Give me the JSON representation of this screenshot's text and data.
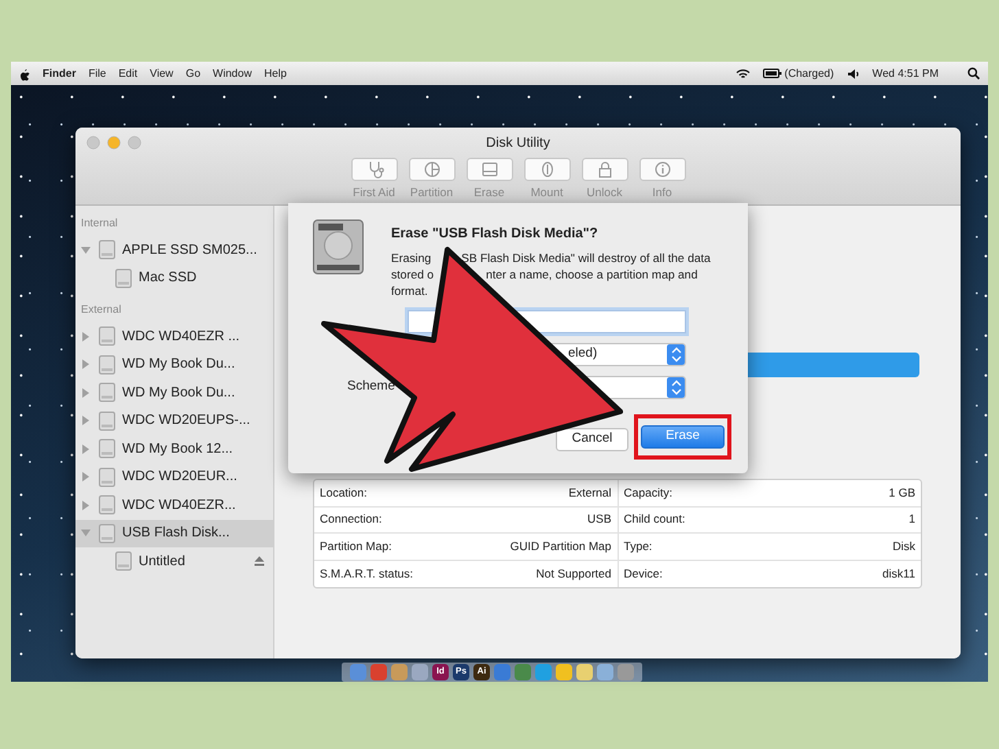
{
  "menu_bar": {
    "app": "Finder",
    "menus": [
      "File",
      "Edit",
      "View",
      "Go",
      "Window",
      "Help"
    ],
    "battery_status": "(Charged)",
    "clock": "Wed 4:51 PM"
  },
  "window": {
    "title": "Disk Utility",
    "toolbar": [
      {
        "label": "First Aid",
        "kind": "firstaid",
        "disabled": true
      },
      {
        "label": "Partition",
        "kind": "partition",
        "disabled": true
      },
      {
        "label": "Erase",
        "kind": "erase",
        "disabled": true
      },
      {
        "label": "Mount",
        "kind": "mount",
        "disabled": true
      },
      {
        "label": "Unlock",
        "kind": "unlock",
        "disabled": true
      },
      {
        "label": "Info",
        "kind": "info",
        "disabled": true
      }
    ],
    "sidebar": [
      {
        "title": "Internal",
        "items": [
          {
            "label": "APPLE SSD SM025...",
            "expanded": true,
            "selected": false,
            "children": [
              {
                "label": "Mac SSD",
                "selected": false,
                "ejectable": false
              }
            ]
          }
        ]
      },
      {
        "title": "External",
        "items": [
          {
            "label": "WDC WD40EZR ...",
            "expanded": false,
            "selected": false
          },
          {
            "label": "WD My Book Du...",
            "expanded": false,
            "selected": false
          },
          {
            "label": "WD My Book Du...",
            "expanded": false,
            "selected": false
          },
          {
            "label": "WDC WD20EUPS-...",
            "expanded": false,
            "selected": false
          },
          {
            "label": "WD My Book 12...",
            "expanded": false,
            "selected": false
          },
          {
            "label": "WDC WD20EUR...",
            "expanded": false,
            "selected": false
          },
          {
            "label": "WDC WD40EZR...",
            "expanded": false,
            "selected": false
          },
          {
            "label": "USB Flash Disk...",
            "expanded": true,
            "selected": true,
            "children": [
              {
                "label": "Untitled",
                "selected": false,
                "ejectable": true
              }
            ]
          }
        ]
      }
    ],
    "info_rows": [
      [
        {
          "label": "Location:",
          "value": "External"
        },
        {
          "label": "Capacity:",
          "value": "1 GB"
        }
      ],
      [
        {
          "label": "Connection:",
          "value": "USB"
        },
        {
          "label": "Child count:",
          "value": "1"
        }
      ],
      [
        {
          "label": "Partition Map:",
          "value": "GUID Partition Map"
        },
        {
          "label": "Type:",
          "value": "Disk"
        }
      ],
      [
        {
          "label": "S.M.A.R.T. status:",
          "value": "Not Supported"
        },
        {
          "label": "Device:",
          "value": "disk11"
        }
      ]
    ]
  },
  "dialog": {
    "title": "Erase \"USB Flash Disk Media\"?",
    "message_lines": [
      [
        "Erasing",
        "SB Flash Disk Media\" will destroy of all the data"
      ],
      [
        "stored o",
        "nter a name, choose a partition map and"
      ],
      [
        "format."
      ]
    ],
    "format_value": "eled)",
    "scheme_label": "Scheme",
    "buttons": [
      {
        "label": "Cancel",
        "kind": "secondary",
        "highlighted": false
      },
      {
        "label": "Erase",
        "kind": "primary",
        "highlighted": true
      }
    ]
  },
  "dock": [
    {
      "color": "#5a8fd8"
    },
    {
      "color": "#d9412f"
    },
    {
      "color": "#c89a5a"
    },
    {
      "color": "#9aa8c0"
    },
    {
      "color": "#8a1450",
      "label": "Id"
    },
    {
      "color": "#1b3a6b",
      "label": "Ps"
    },
    {
      "color": "#3d2a10",
      "label": "Ai"
    },
    {
      "color": "#3a7bd5"
    },
    {
      "color": "#4a8a4a"
    },
    {
      "color": "#20a0e0"
    },
    {
      "color": "#f0c020"
    },
    {
      "color": "#e8d070"
    },
    {
      "color": "#8ab0d8"
    },
    {
      "color": "#999999"
    }
  ]
}
